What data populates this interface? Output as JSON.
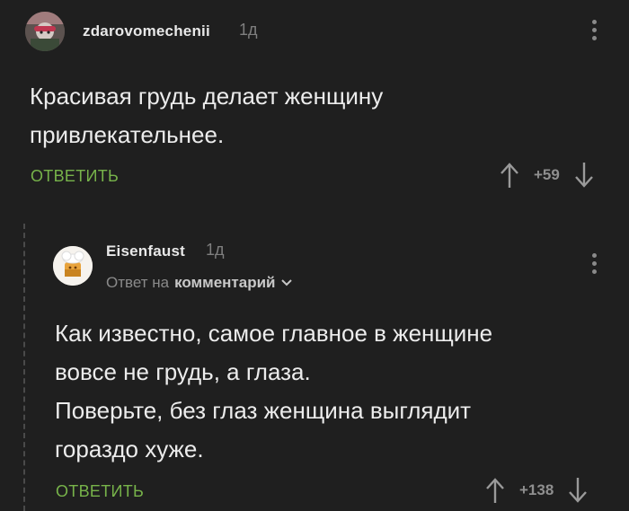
{
  "comments": [
    {
      "username": "zdarovomechenii",
      "time": "1д",
      "avatar_icon": "user-avatar-icon",
      "text_lines": [
        "Красивая грудь делает женщину",
        "привлекательнее."
      ],
      "reply_label": "ОТВЕТИТЬ",
      "rating": "+59"
    },
    {
      "username": "Eisenfaust",
      "time": "1д",
      "avatar_icon": "user-avatar-icon",
      "reply_to_prefix": "Ответ на",
      "reply_to_link": "комментарий",
      "text_lines": [
        "Как известно, самое главное в женщине",
        "вовсе не грудь, а глаза.",
        "Поверьте, без глаз женщина выглядит",
        "гораздо хуже."
      ],
      "reply_label": "ОТВЕТИТЬ",
      "rating": "+138"
    }
  ],
  "colors": {
    "background": "#1f1f1f",
    "accent_green": "#77b34a",
    "muted": "#8a8a8a"
  }
}
